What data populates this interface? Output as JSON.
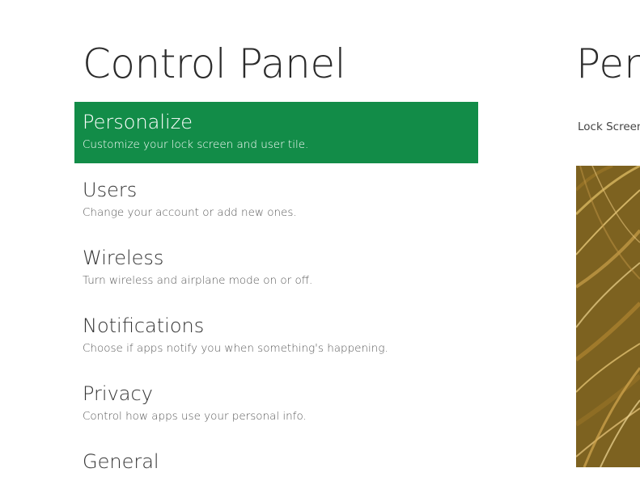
{
  "left_panel": {
    "title": "Control Panel",
    "items": [
      {
        "title": "Personalize",
        "description": "Customize your lock screen and user tile.",
        "selected": true
      },
      {
        "title": "Users",
        "description": "Change your account or add new ones.",
        "selected": false
      },
      {
        "title": "Wireless",
        "description": "Turn wireless and airplane mode on or off.",
        "selected": false
      },
      {
        "title": "Notifications",
        "description": "Choose if apps notify you when something's happening.",
        "selected": false
      },
      {
        "title": "Privacy",
        "description": "Control how apps use your personal info.",
        "selected": false
      },
      {
        "title": "General",
        "description": "",
        "selected": false
      }
    ]
  },
  "right_panel": {
    "title": "Pers",
    "subtitle": "Lock Screen"
  },
  "colors": {
    "selected_background": "#128c48",
    "background": "#ffffff",
    "text": "#2b2b2b"
  }
}
